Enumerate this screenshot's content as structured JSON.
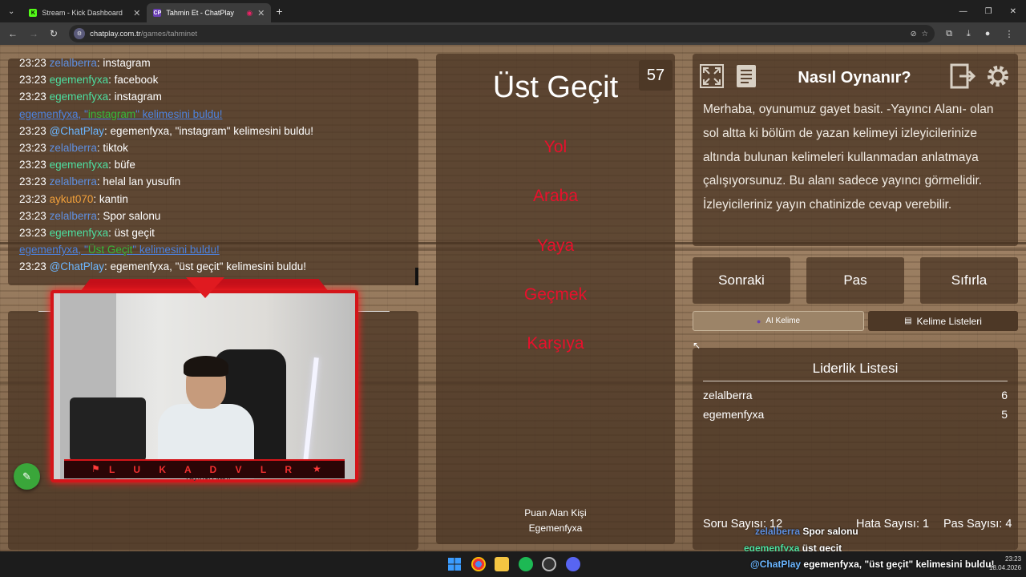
{
  "browser": {
    "tabs": [
      {
        "favicon": "K",
        "title": "Stream - Kick Dashboard",
        "active": false
      },
      {
        "favicon": "CP",
        "title": "Tahmin Et - ChatPlay",
        "active": true
      }
    ],
    "url_domain": "chatplay.com.tr",
    "url_path": "/games/tahminet"
  },
  "chat": {
    "lines": [
      {
        "time": "23:23",
        "user": "zelalberra",
        "color": "pink",
        "msg": ": instagram"
      },
      {
        "time": "23:23",
        "user": "egemenfyxa",
        "color": "green",
        "msg": ": facebook"
      },
      {
        "time": "23:23",
        "user": "egemenfyxa",
        "color": "green",
        "msg": ": instagram"
      },
      {
        "time": "",
        "user": "",
        "color": "sys",
        "msg": "",
        "system": {
          "pre": "egemenfyxa, \"",
          "word": "instagram",
          "post": "\" kelimesini buldu!"
        }
      },
      {
        "time": "23:23",
        "user": "@ChatPlay",
        "color": "bot",
        "msg": ": egemenfyxa, \"instagram\" kelimesini buldu!"
      },
      {
        "time": "23:23",
        "user": "zelalberra",
        "color": "pink",
        "msg": ": tiktok"
      },
      {
        "time": "23:23",
        "user": "egemenfyxa",
        "color": "green",
        "msg": ": büfe"
      },
      {
        "time": "23:23",
        "user": "zelalberra",
        "color": "pink",
        "msg": ": helal lan yusufin"
      },
      {
        "time": "23:23",
        "user": "aykut070",
        "color": "orange",
        "msg": ": kantin"
      },
      {
        "time": "23:23",
        "user": "zelalberra",
        "color": "pink",
        "msg": ": Spor salonu"
      },
      {
        "time": "23:23",
        "user": "egemenfyxa",
        "color": "green",
        "msg": ": üst geçit"
      },
      {
        "time": "",
        "user": "",
        "color": "sys",
        "msg": "",
        "system": {
          "pre": "egemenfyxa, \"",
          "word": "Üst Geçit",
          "post": "\" kelimesini buldu!"
        }
      },
      {
        "time": "23:23",
        "user": "@ChatPlay",
        "color": "bot",
        "msg": ": egemenfyxa, \"üst geçit\" kelimesini buldu!"
      }
    ]
  },
  "webcam": {
    "streamer_name": "L U K A D V L R",
    "caption": "Yayıncı Alanı"
  },
  "game": {
    "timer": "57",
    "word": "Üst Geçit",
    "forbidden": [
      "Yol",
      "Araba",
      "Yaya",
      "Geçmek",
      "Karşıya"
    ],
    "scorer_label": "Puan Alan Kişi",
    "scorer_name": "Egemenfyxa"
  },
  "howto": {
    "title": "Nasıl Oynanır?",
    "text": "Merhaba, oyunumuz gayet basit. -Yayıncı Alanı- olan sol altta ki bölüm de yazan kelimeyi izleyicilerinize altında bulunan kelimeleri kullanmadan anlatmaya çalışıyorsunuz. Bu alanı sadece yayıncı görmelidir. İzleyicileriniz yayın chatinizde cevap verebilir."
  },
  "controls": {
    "next": "Sonraki",
    "pass": "Pas",
    "reset": "Sıfırla",
    "ai_word": "AI Kelime",
    "word_lists": "Kelime Listeleri"
  },
  "leaderboard": {
    "title": "Liderlik Listesi",
    "rows": [
      {
        "name": "zelalberra",
        "score": "6"
      },
      {
        "name": "egemenfyxa",
        "score": "5"
      }
    ]
  },
  "stats": {
    "questions": "Soru Sayısı: 12",
    "errors": "Hata Sayısı: 1",
    "passes": "Pas Sayısı: 4"
  },
  "overlay_chat": [
    {
      "user": "zelalberra",
      "msg": "Spor salonu",
      "user_color": "#5e8fe0"
    },
    {
      "user": "egemenfyxa",
      "msg": "üst geçit",
      "user_color": "#4ddfa0"
    },
    {
      "user": "@ChatPlay",
      "msg": "egemenfyxa, \"üst geçit\" kelimesini buldu!",
      "user_color": "#6bb6ff"
    }
  ],
  "taskbar": {
    "time": "23:23",
    "date": "18.04.2026"
  }
}
